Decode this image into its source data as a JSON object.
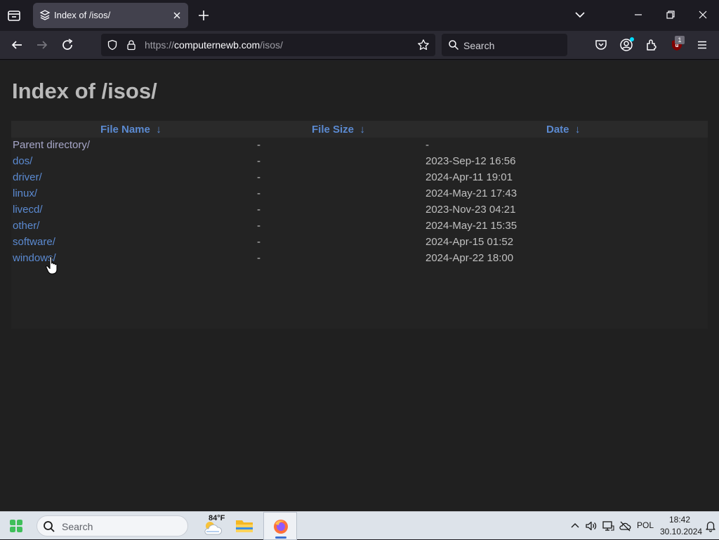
{
  "browser": {
    "tab": {
      "title": "Index of /isos/"
    },
    "url": {
      "scheme": "https://",
      "host": "computernewb.com",
      "path": "/isos/"
    },
    "search": {
      "placeholder": "Search"
    },
    "extension_badge": "1"
  },
  "page": {
    "title": "Index of /isos/",
    "columns": [
      {
        "label": "File Name",
        "sort": "↓"
      },
      {
        "label": "File Size",
        "sort": "↓"
      },
      {
        "label": "Date",
        "sort": "↓"
      }
    ],
    "rows": [
      {
        "name": "Parent directory/",
        "size": "-",
        "date": "-",
        "is_parent": true
      },
      {
        "name": "dos/",
        "size": "-",
        "date": "2023-Sep-12 16:56"
      },
      {
        "name": "driver/",
        "size": "-",
        "date": "2024-Apr-11 19:01"
      },
      {
        "name": "linux/",
        "size": "-",
        "date": "2024-May-21 17:43"
      },
      {
        "name": "livecd/",
        "size": "-",
        "date": "2023-Nov-23 04:21"
      },
      {
        "name": "other/",
        "size": "-",
        "date": "2024-May-21 15:35"
      },
      {
        "name": "software/",
        "size": "-",
        "date": "2024-Apr-15 01:52"
      },
      {
        "name": "windows/",
        "size": "-",
        "date": "2024-Apr-22 18:00"
      }
    ]
  },
  "taskbar": {
    "search_placeholder": "Search",
    "weather_temp": "84°F",
    "language": "POL",
    "time": "18:42",
    "date": "30.10.2024"
  },
  "colors": {
    "link": "#5b8ad1",
    "page_bg": "#202020",
    "title": "#b9b9b9",
    "text": "#c0c0c0"
  },
  "icons": [
    "tab-list-icon",
    "globe-favicon-icon",
    "close-icon",
    "plus-icon",
    "chevron-down-icon",
    "minimize-icon",
    "restore-icon",
    "back-arrow-icon",
    "forward-arrow-icon",
    "reload-icon",
    "shield-icon",
    "lock-icon",
    "star-icon",
    "search-icon",
    "pocket-icon",
    "account-icon",
    "extensions-icon",
    "ublock-icon",
    "menu-icon",
    "windows-start-icon",
    "weather-icon",
    "folder-icon",
    "firefox-icon",
    "chevron-up-icon",
    "speaker-icon",
    "network-icon",
    "cloud-icon",
    "bell-icon"
  ]
}
